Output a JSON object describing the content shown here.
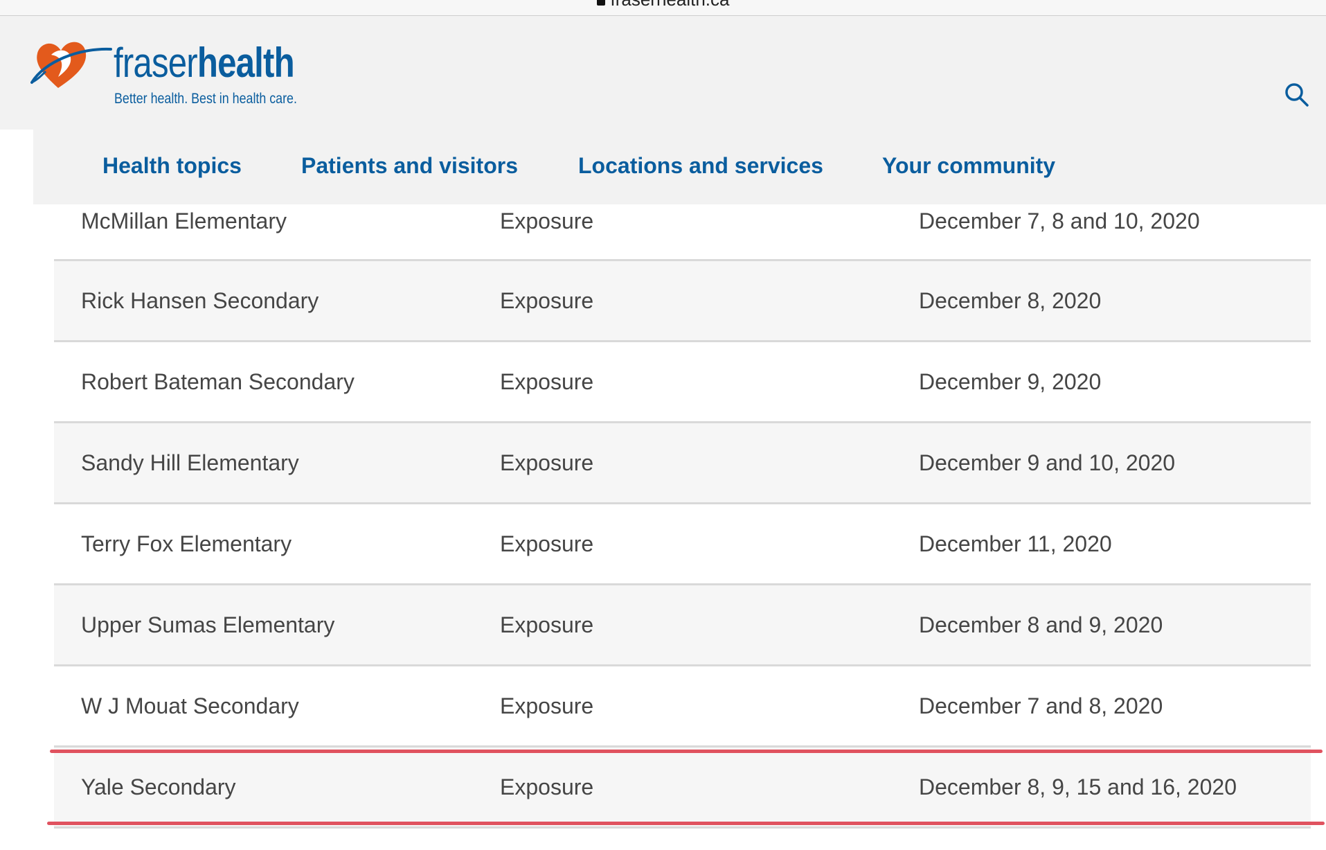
{
  "browser": {
    "url": "fraserhealth.ca"
  },
  "header": {
    "brand_light": "fraser",
    "brand_bold": "health",
    "tagline": "Better health. Best in health care.",
    "search_icon": "search-icon"
  },
  "nav": {
    "items": [
      {
        "label": "Health topics"
      },
      {
        "label": "Patients and visitors"
      },
      {
        "label": "Locations and services"
      },
      {
        "label": "Your community"
      }
    ]
  },
  "table": {
    "rows": [
      {
        "school": "McMillan Elementary",
        "type": "Exposure",
        "dates": "December 7, 8 and 10, 2020"
      },
      {
        "school": "Rick Hansen Secondary",
        "type": "Exposure",
        "dates": "December 8, 2020"
      },
      {
        "school": "Robert Bateman Secondary",
        "type": "Exposure",
        "dates": "December 9, 2020"
      },
      {
        "school": "Sandy Hill Elementary",
        "type": "Exposure",
        "dates": "December 9 and 10, 2020"
      },
      {
        "school": "Terry Fox Elementary",
        "type": "Exposure",
        "dates": "December 11, 2020"
      },
      {
        "school": "Upper Sumas Elementary",
        "type": "Exposure",
        "dates": "December 8 and 9, 2020"
      },
      {
        "school": "W J Mouat Secondary",
        "type": "Exposure",
        "dates": "December 7 and 8, 2020"
      },
      {
        "school": "Yale Secondary",
        "type": "Exposure",
        "dates": "December 8, 9, 15 and 16, 2020"
      }
    ]
  },
  "colors": {
    "brand_blue": "#0a5d9e",
    "logo_orange": "#e35a1c",
    "highlight_red": "#e0525f"
  }
}
